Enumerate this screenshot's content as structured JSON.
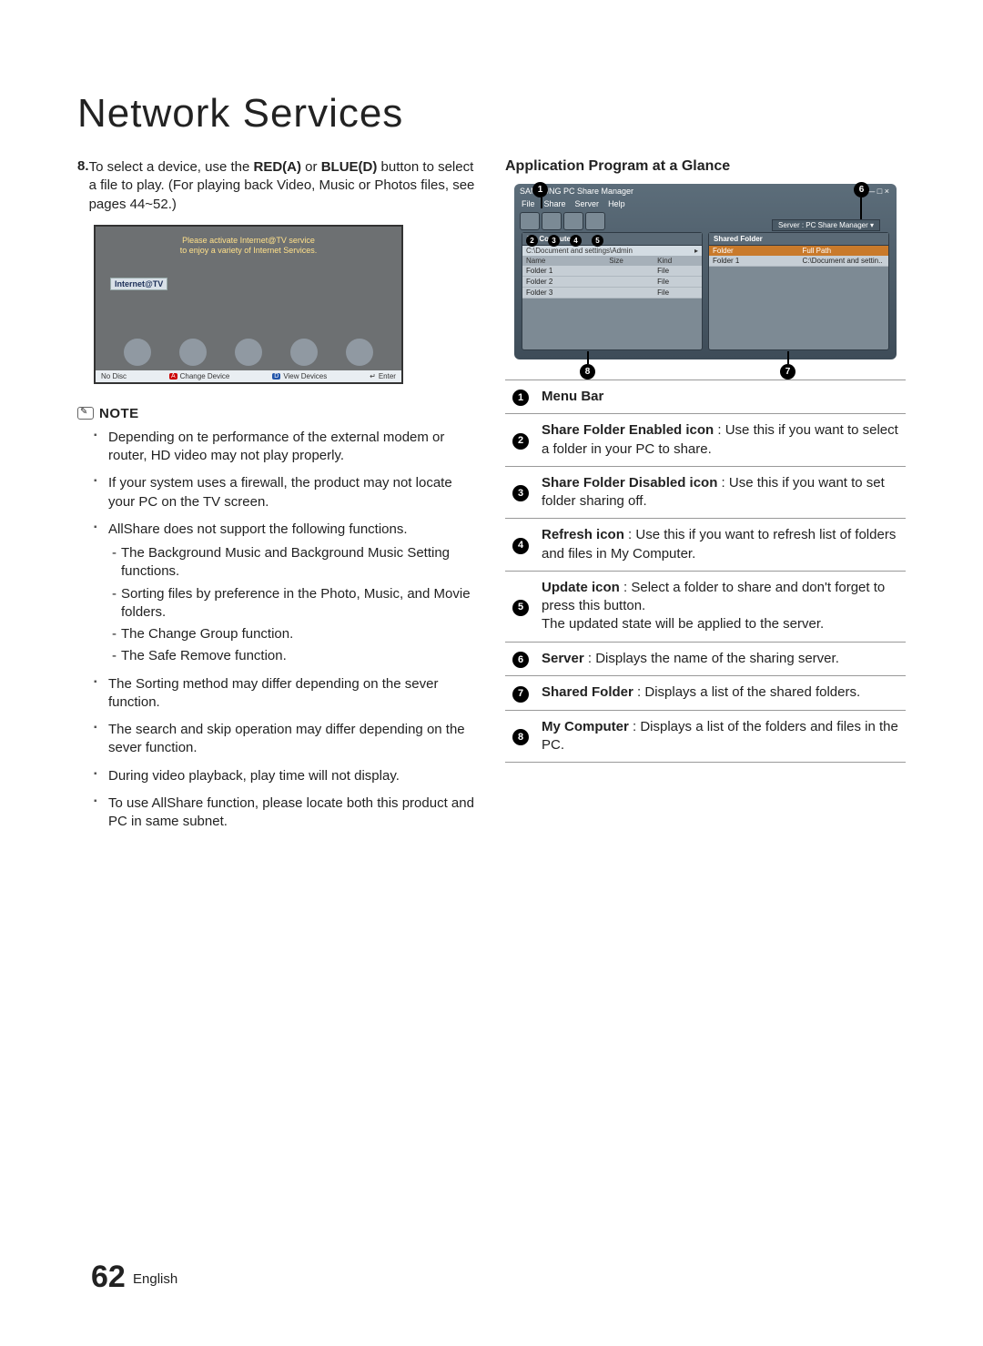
{
  "title": "Network Services",
  "step": {
    "num": "8.",
    "text_pre": "To select a device, use the ",
    "bold1": "RED(A)",
    "text_mid": " or ",
    "bold2": "BLUE(D)",
    "text_post": " button to select a file to play. (For playing back Video, Music or Photos files, see pages 44~52.)"
  },
  "tv": {
    "banner1": "Please activate Internet@TV service",
    "banner2": "to enjoy a variety of Internet Services.",
    "logo": "Internet@TV",
    "nodisc": "No Disc",
    "change": "Change Device",
    "view": "View Devices",
    "enter": "Enter"
  },
  "note_label": "NOTE",
  "notes": [
    "Depending on te performance of the external modem or router, HD video may not play properly.",
    "If your system uses a firewall, the product may not locate your PC on the TV screen.",
    "AllShare does not support the following functions.",
    "The Sorting method may differ depending on the sever function.",
    "The search and skip operation may differ depending on the sever function.",
    "During video playback, play time will not display.",
    "To use AllShare function, please locate both this product and PC in same subnet."
  ],
  "subnotes": [
    "The Background Music and Background Music Setting functions.",
    "Sorting files by preference in the Photo, Music, and Movie folders.",
    "The Change Group function.",
    "The Safe Remove function."
  ],
  "right_title": "Application Program at a Glance",
  "app": {
    "window_title": "SAMSUNG PC Share Manager",
    "menus": [
      "File",
      "Share",
      "Server",
      "Help"
    ],
    "server_label": "Server : PC Share Manager ▾",
    "left_panel_h": "My Computer",
    "right_panel_h": "Shared Folder",
    "path": "C:\\Document and settings\\Admin",
    "lcols": [
      "Name",
      "Size",
      "Kind"
    ],
    "rcols": [
      "Folder",
      "Full Path"
    ],
    "lrows": [
      [
        "Folder 1",
        "",
        "File"
      ],
      [
        "Folder 2",
        "",
        "File"
      ],
      [
        "Folder 3",
        "",
        "File"
      ]
    ],
    "rrows": [
      [
        "Folder 1",
        "C:\\Document and settin.."
      ]
    ]
  },
  "legend": [
    {
      "n": "1",
      "bold": "Menu Bar",
      "rest": ""
    },
    {
      "n": "2",
      "bold": "Share Folder Enabled icon",
      "rest": " : Use this if you want to select a folder in your PC to share."
    },
    {
      "n": "3",
      "bold": "Share Folder Disabled icon",
      "rest": " : Use this if you want to set folder sharing off."
    },
    {
      "n": "4",
      "bold": "Refresh icon",
      "rest": " : Use this if you want to refresh list of folders and files in My Computer."
    },
    {
      "n": "5",
      "bold": "Update icon",
      "rest": " : Select a folder to share and don't forget to press this button.\nThe updated state will be applied to the server."
    },
    {
      "n": "6",
      "bold": "Server",
      "rest": " : Displays the name of the sharing server."
    },
    {
      "n": "7",
      "bold": "Shared Folder",
      "rest": " : Displays a list of the shared folders."
    },
    {
      "n": "8",
      "bold": "My Computer",
      "rest": " : Displays a list of the folders and files in the PC."
    }
  ],
  "footer": {
    "page": "62",
    "lang": "English"
  }
}
